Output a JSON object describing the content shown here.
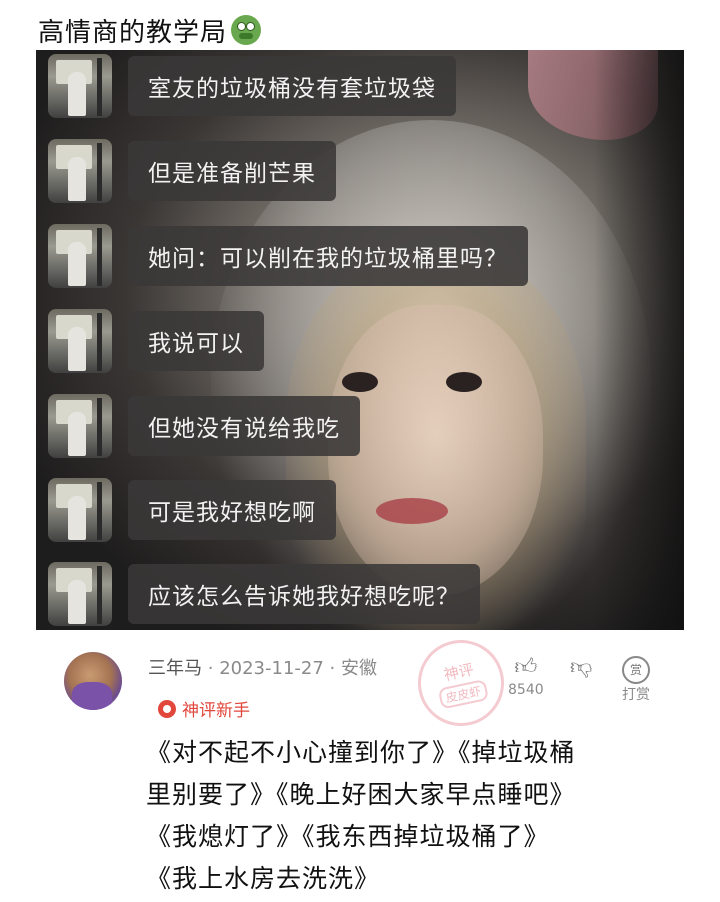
{
  "header": {
    "title": "高情商的教学局",
    "emoji": "nauseated-face-icon"
  },
  "chat": {
    "messages": [
      "室友的垃圾桶没有套垃圾袋",
      "但是准备削芒果",
      "她问：可以削在我的垃圾桶里吗？",
      "我说可以",
      "但她没有说给我吃",
      "可是我好想吃啊",
      "应该怎么告诉她我好想吃呢？"
    ]
  },
  "comment": {
    "username": "三年马",
    "date": "2023-11-27",
    "location": "安徽",
    "badge": "神评新手",
    "stamp_line1": "神评",
    "stamp_line2": "皮皮虾",
    "likes": "8540",
    "tip_label": "打赏",
    "tip_coin": "赏",
    "lines": [
      "《对不起不小心撞到你了》《掉垃圾桶",
      "里别要了》《晚上好困大家早点睡吧》",
      "《我熄灯了》《我东西掉垃圾桶了》",
      "《我上水房去洗洗》"
    ]
  },
  "colors": {
    "badge": "#e2473c",
    "bubble": "#3a3838",
    "meta": "#8a8a8a"
  }
}
